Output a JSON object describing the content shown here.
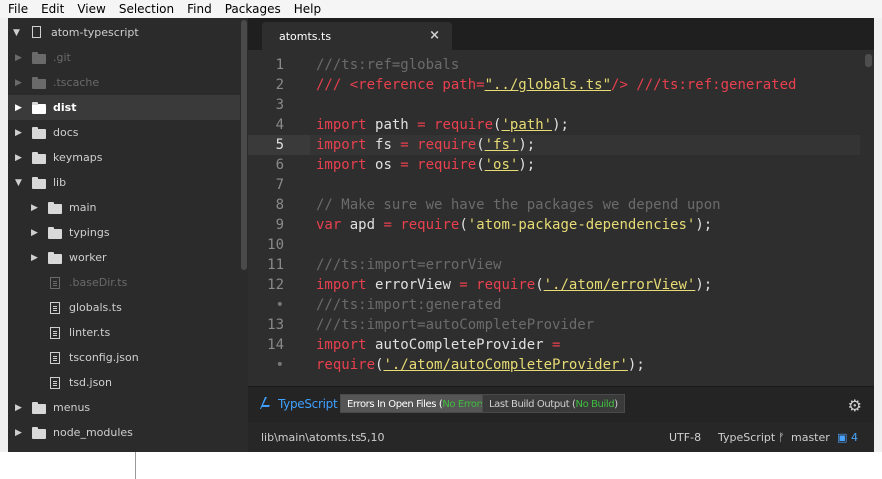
{
  "menubar": [
    "File",
    "Edit",
    "View",
    "Selection",
    "Find",
    "Packages",
    "Help"
  ],
  "tree": {
    "root": "atom-typescript",
    "items": [
      {
        "label": ".git",
        "kind": "folder",
        "depth": 1,
        "dim": true,
        "arrow": "right"
      },
      {
        "label": ".tscache",
        "kind": "folder",
        "depth": 1,
        "dim": true,
        "arrow": "right"
      },
      {
        "label": "dist",
        "kind": "folder",
        "depth": 1,
        "selected": true,
        "arrow": "right"
      },
      {
        "label": "docs",
        "kind": "folder",
        "depth": 1,
        "arrow": "right"
      },
      {
        "label": "keymaps",
        "kind": "folder",
        "depth": 1,
        "arrow": "right"
      },
      {
        "label": "lib",
        "kind": "folder",
        "depth": 1,
        "arrow": "down"
      },
      {
        "label": "main",
        "kind": "folder",
        "depth": 2,
        "arrow": "right"
      },
      {
        "label": "typings",
        "kind": "folder",
        "depth": 2,
        "arrow": "right"
      },
      {
        "label": "worker",
        "kind": "folder",
        "depth": 2,
        "arrow": "right"
      },
      {
        "label": ".baseDir.ts",
        "kind": "file",
        "depth": 2,
        "dim": true
      },
      {
        "label": "globals.ts",
        "kind": "file",
        "depth": 2
      },
      {
        "label": "linter.ts",
        "kind": "file",
        "depth": 2
      },
      {
        "label": "tsconfig.json",
        "kind": "file",
        "depth": 2
      },
      {
        "label": "tsd.json",
        "kind": "file",
        "depth": 2
      },
      {
        "label": "menus",
        "kind": "folder",
        "depth": 1,
        "arrow": "right"
      },
      {
        "label": "node_modules",
        "kind": "folder",
        "depth": 1,
        "arrow": "right"
      }
    ]
  },
  "tab": {
    "label": "atomts.ts",
    "close": "×"
  },
  "gutter": [
    "1",
    "2",
    "3",
    "4",
    "5",
    "6",
    "7",
    "8",
    "9",
    "10",
    "11",
    "12",
    "•",
    "13",
    "14",
    "•"
  ],
  "current_line": "5",
  "code": [
    [
      {
        "t": "///ts:ref=globals",
        "c": "cm"
      }
    ],
    [
      {
        "t": "/// ",
        "c": "kw"
      },
      {
        "t": "<reference path=",
        "c": "kw"
      },
      {
        "t": "\"../globals.ts\"",
        "c": "str"
      },
      {
        "t": "/> ///ts:ref:generated",
        "c": "kw"
      }
    ],
    [],
    [
      {
        "t": "import ",
        "c": "kw"
      },
      {
        "t": "path",
        "c": "pl"
      },
      {
        "t": " = ",
        "c": "op"
      },
      {
        "t": "require",
        "c": "kw"
      },
      {
        "t": "(",
        "c": "pl"
      },
      {
        "t": "'path'",
        "c": "str"
      },
      {
        "t": ");",
        "c": "pl"
      }
    ],
    [
      {
        "t": "import ",
        "c": "kw"
      },
      {
        "t": "fs",
        "c": "pl"
      },
      {
        "t": " = ",
        "c": "op"
      },
      {
        "t": "require",
        "c": "kw"
      },
      {
        "t": "(",
        "c": "pl"
      },
      {
        "t": "'fs'",
        "c": "str"
      },
      {
        "t": ");",
        "c": "pl"
      }
    ],
    [
      {
        "t": "import ",
        "c": "kw"
      },
      {
        "t": "os",
        "c": "pl"
      },
      {
        "t": " = ",
        "c": "op"
      },
      {
        "t": "require",
        "c": "kw"
      },
      {
        "t": "(",
        "c": "pl"
      },
      {
        "t": "'os'",
        "c": "str"
      },
      {
        "t": ");",
        "c": "pl"
      }
    ],
    [],
    [
      {
        "t": "// Make sure we have the packages we depend upon",
        "c": "cm"
      }
    ],
    [
      {
        "t": "var ",
        "c": "kw"
      },
      {
        "t": "apd",
        "c": "pl"
      },
      {
        "t": " = ",
        "c": "op"
      },
      {
        "t": "require",
        "c": "kw"
      },
      {
        "t": "(",
        "c": "pl"
      },
      {
        "t": "'atom-package-dependencies'",
        "c": "strn"
      },
      {
        "t": ");",
        "c": "pl"
      }
    ],
    [],
    [
      {
        "t": "///ts:import=errorView",
        "c": "cm"
      }
    ],
    [
      {
        "t": "import ",
        "c": "kw"
      },
      {
        "t": "errorView",
        "c": "pl"
      },
      {
        "t": " = ",
        "c": "op"
      },
      {
        "t": "require",
        "c": "kw"
      },
      {
        "t": "(",
        "c": "pl"
      },
      {
        "t": "'./atom/errorView'",
        "c": "str"
      },
      {
        "t": ");",
        "c": "pl"
      }
    ],
    [
      {
        "t": "///ts:import:generated",
        "c": "cm"
      }
    ],
    [
      {
        "t": "///ts:import=autoCompleteProvider",
        "c": "cm"
      }
    ],
    [
      {
        "t": "import ",
        "c": "kw"
      },
      {
        "t": "autoCompleteProvider",
        "c": "pl"
      },
      {
        "t": " =",
        "c": "op"
      }
    ],
    [
      {
        "t": "require",
        "c": "kw"
      },
      {
        "t": "(",
        "c": "pl"
      },
      {
        "t": "'./atom/autoCompleteProvider'",
        "c": "str"
      },
      {
        "t": ");",
        "c": "pl"
      }
    ]
  ],
  "panel": {
    "brand": "TypeScript",
    "errors_label": "Errors In Open Files (",
    "errors_status": "No Errors",
    "errors_close": ")",
    "build_label": "Last Build Output (",
    "build_status": "No Build",
    "build_close": ")"
  },
  "status": {
    "path": "lib\\main\\atomts.ts",
    "cursor": "5,10",
    "encoding": "UTF-8",
    "grammar": "TypeScript",
    "branch": "master",
    "packages_count": "4"
  },
  "colors": {
    "keyword": "#e8404e",
    "string": "#e6db74",
    "comment": "#6b6b6b",
    "accent": "#3fa0ff",
    "ok": "#3fbf3f"
  }
}
